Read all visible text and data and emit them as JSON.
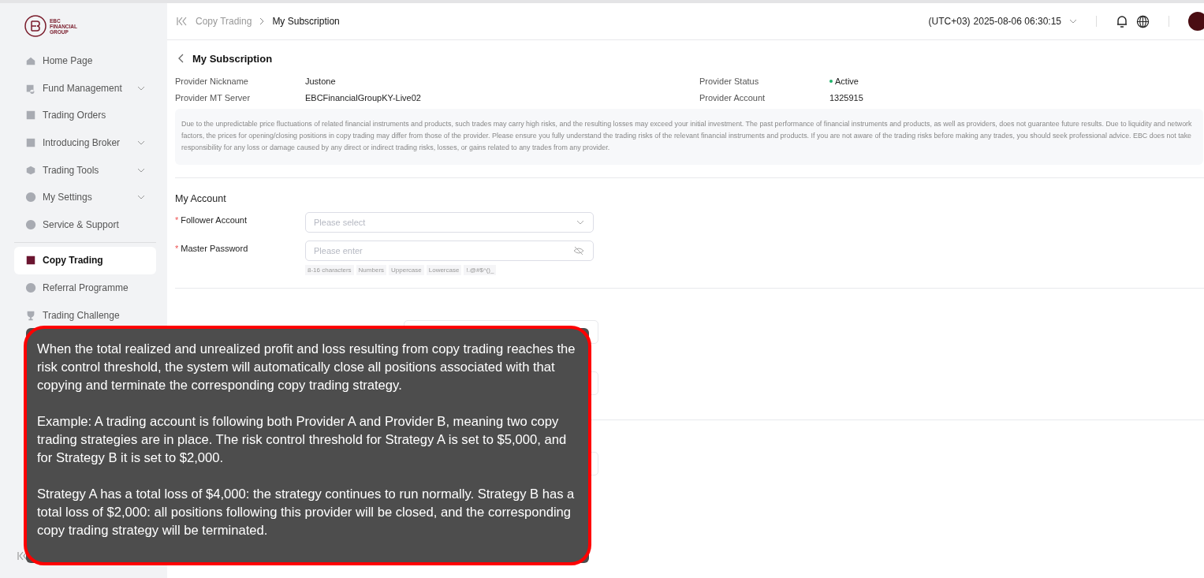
{
  "sidebar": {
    "logo_text": [
      "EBC",
      "FINANCIAL",
      "GROUP"
    ],
    "items": [
      {
        "label": "Home Page",
        "expandable": false,
        "selected": false
      },
      {
        "label": "Fund Management",
        "expandable": true,
        "selected": false
      },
      {
        "label": "Trading Orders",
        "expandable": false,
        "selected": false
      },
      {
        "label": "Introducing Broker",
        "expandable": true,
        "selected": false
      },
      {
        "label": "Trading Tools",
        "expandable": true,
        "selected": false
      },
      {
        "label": "My Settings",
        "expandable": true,
        "selected": false
      },
      {
        "label": "Service & Support",
        "expandable": false,
        "selected": false
      },
      {
        "label": "Copy Trading",
        "expandable": false,
        "selected": true
      },
      {
        "label": "Referral Programme",
        "expandable": false,
        "selected": false
      },
      {
        "label": "Trading Challenge",
        "expandable": false,
        "selected": false
      }
    ]
  },
  "breadcrumb": [
    "Copy Trading",
    "My Subscription"
  ],
  "header": {
    "timezone": "(UTC+03)",
    "datetime": "2025-08-06 06:30:15"
  },
  "page_title": "My Subscription",
  "provider_info": [
    {
      "label": "Provider Nickname",
      "value": "Justone"
    },
    {
      "label": "Provider Status",
      "value": "Active",
      "color": "#1fb36b"
    },
    {
      "label": "Provider MT Server",
      "value": "EBCFinancialGroupKY-Live02"
    },
    {
      "label": "Provider Account",
      "value": "1325915"
    }
  ],
  "disclaimer": "Due to the unpredictable price fluctuations of related financial instruments and products, such trades may carry high risks, and the resulting losses may exceed your initial investment. The past performance of financial instruments and products, as well as providers, does not guarantee future results. Due to liquidity and network factors, the prices for opening/closing positions in copy trading may differ from those of the provider. Please ensure you fully understand the trading risks of the relevant financial instruments and products. If you are not aware of the trading risks before making any trades, you should seek professional advice. EBC does not take responsibility for any loss or damage caused by any direct or indirect trading risks, losses, or gains related to any trades from any provider.",
  "my_account": {
    "title": "My Account",
    "fields": [
      {
        "label": "Follower Account",
        "kind": "select",
        "placeholder": "Please select",
        "required_mark": "*"
      },
      {
        "label": "Master Password",
        "kind": "password",
        "placeholder": "Please enter",
        "required_mark": "*"
      }
    ],
    "password_rules": [
      "8-16 characters",
      "Numbers",
      "Uppercase",
      "Lowercase",
      "!.@#$^()_"
    ]
  },
  "tooltip": {
    "paragraphs": [
      "When the total realized and unrealized profit and loss resulting from copy trading reaches the risk control threshold, the system will automatically close all positions associated with that copying and terminate the corresponding copy trading strategy.",
      "Example: A trading account is following both Provider A and Provider B, meaning two copy trading strategies are in place. The risk control threshold for Strategy A is set to $5,000, and for Strategy B it is set to $2,000.",
      "Strategy A has a total loss of $4,000: the strategy continues to run normally. Strategy B has a total loss of $2,000: all positions following this provider will be closed, and the corresponding copy trading strategy will be terminated."
    ],
    "highlighted": true
  }
}
